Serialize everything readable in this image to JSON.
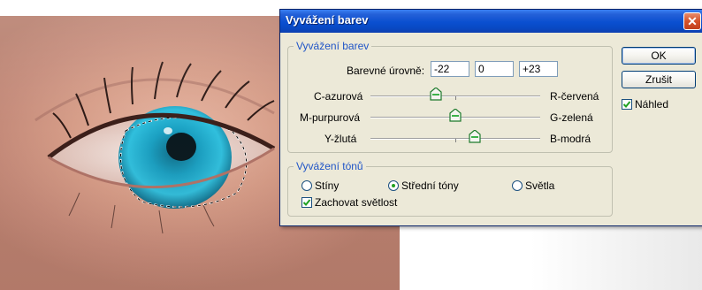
{
  "dialog": {
    "title": "Vyvážení barev",
    "close_label": "✕"
  },
  "color_balance": {
    "legend": "Vyvážení barev",
    "levels_label": "Barevné úrovně:",
    "levels": [
      "-22",
      "0",
      "+23"
    ],
    "sliders": [
      {
        "left": "C-azurová",
        "right": "R-červená",
        "value": -22
      },
      {
        "left": "M-purpurová",
        "right": "G-zelená",
        "value": 0
      },
      {
        "left": "Y-žlutá",
        "right": "B-modrá",
        "value": 23
      }
    ]
  },
  "tone_balance": {
    "legend": "Vyvážení tónů",
    "options": [
      "Stíny",
      "Střední tóny",
      "Světla"
    ],
    "selected": "Střední tóny",
    "preserve_label": "Zachovat světlost",
    "preserve_checked": true
  },
  "buttons": {
    "ok": "OK",
    "cancel": "Zrušit"
  },
  "preview": {
    "label": "Náhled",
    "checked": true
  }
}
